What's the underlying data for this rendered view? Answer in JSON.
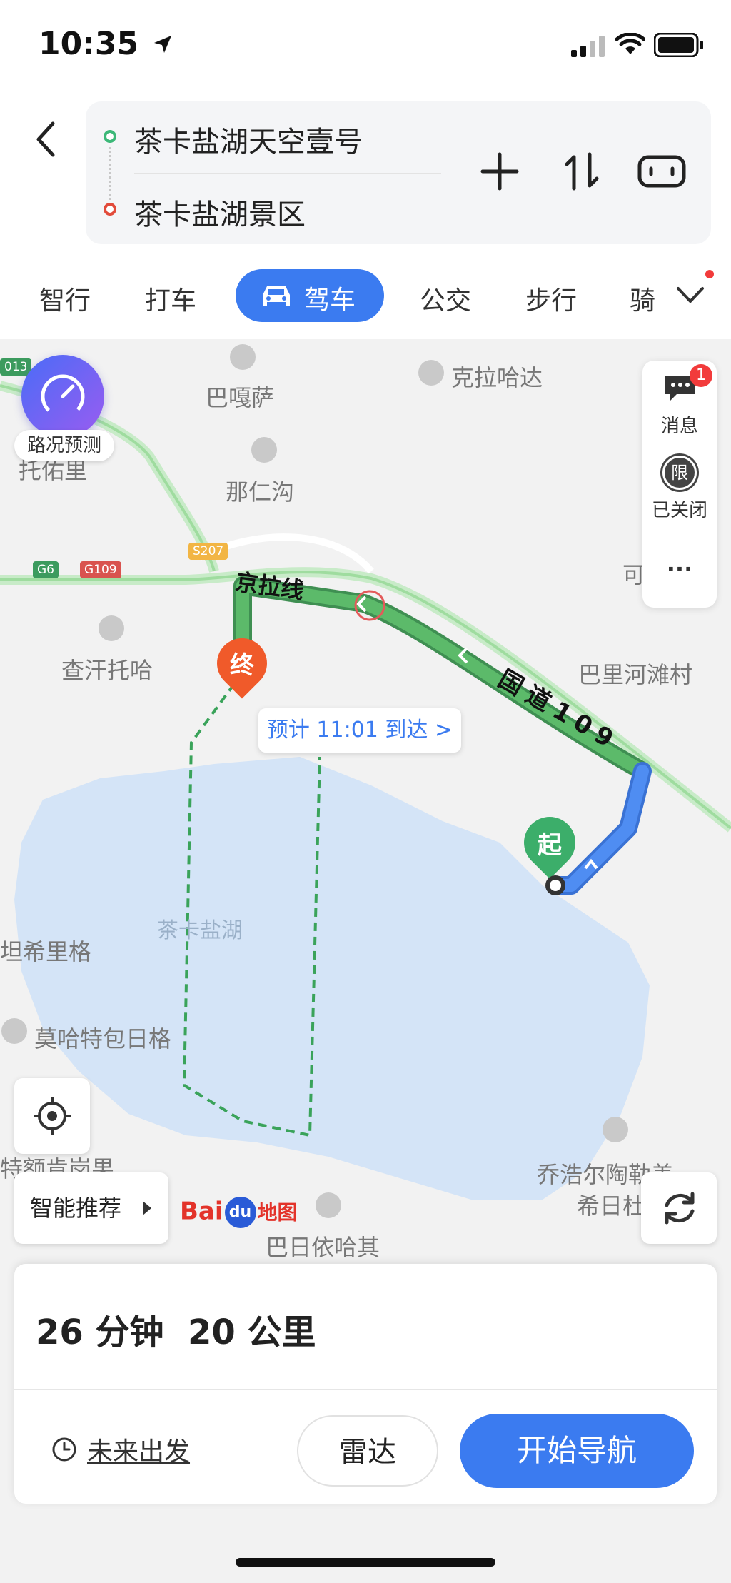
{
  "status_bar": {
    "time": "10:35",
    "location_icon": "location-arrow-icon",
    "signal_icon": "signal-icon",
    "wifi_icon": "wifi-icon",
    "battery_icon": "battery-icon"
  },
  "header": {
    "back_icon": "chevron-left-icon",
    "start": "茶卡盐湖天空壹号",
    "end": "茶卡盐湖景区",
    "add_icon": "plus-icon",
    "swap_icon": "swap-icon",
    "vr_icon": "vr-goggles-icon"
  },
  "modes": {
    "items": [
      "智行",
      "打车",
      "驾车",
      "公交",
      "步行",
      "骑"
    ],
    "active": "驾车",
    "more_icon": "chevron-down-icon"
  },
  "map": {
    "traffic_predict": "路况预测",
    "places": [
      "巴嘎萨",
      "克拉哈达",
      "那仁沟",
      "查汗托哈",
      "巴里河滩村",
      "坦希里格",
      "莫哈特包日格",
      "特额肯岗果",
      "乔浩尔陶勒盖",
      "希日杜",
      "巴日依哈其",
      "托佑里",
      "可"
    ],
    "lake": "茶卡盐湖",
    "roads": {
      "g6": "G6",
      "g109": "G109",
      "s207": "S207",
      "g013": "013",
      "jingla": "京拉线",
      "guodao": "国道109"
    },
    "start_marker": "起",
    "end_marker": "终",
    "eta": "预计 11:01 到达 >",
    "messages_label": "消息",
    "messages_badge": "1",
    "limit_icon_text": "限",
    "limit_label": "已关闭",
    "more_label": "···",
    "smart_recommend": "智能推荐",
    "logo_text": "Bai",
    "logo_suffix": "地图",
    "logo_paw": "du"
  },
  "summary": {
    "duration": "26 分钟",
    "distance": "20 公里"
  },
  "actions": {
    "future": "未来出发",
    "radar": "雷达",
    "start_nav": "开始导航"
  },
  "colors": {
    "accent": "#3b7bf0",
    "route_green": "#5cba6a",
    "route_blue": "#4f8df2",
    "lake": "#d4e4f7"
  }
}
